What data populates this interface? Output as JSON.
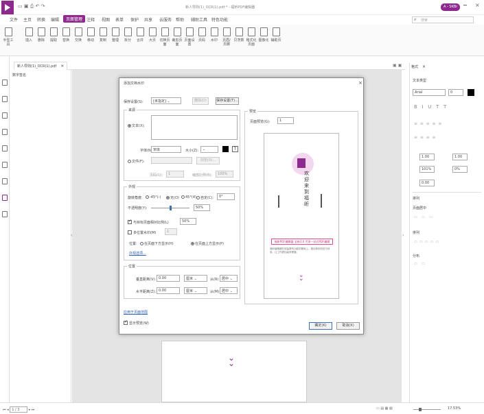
{
  "window": {
    "title": "新人导则(1)_OCR(1).pdf * - 福昕PDF编辑器",
    "user": "A - SKBr"
  },
  "menu": {
    "items": [
      "文件",
      "主页",
      "转换",
      "编辑",
      "页面管理",
      "注释",
      "视图",
      "表单",
      "保护",
      "共享",
      "云服务",
      "帮助"
    ],
    "extra": [
      "辅助工具",
      "特色功能"
    ],
    "search_placeholder": "搜索"
  },
  "ribbon": {
    "buttons": [
      "手型工具",
      "插入",
      "删除",
      "提取",
      "替换",
      "交换",
      "移动",
      "复制",
      "整理",
      "拆分",
      "合并",
      "大页",
      "切换页面",
      "裁剪页面",
      "页面设置",
      "页码",
      "水印",
      "页眉/页脚",
      "贝茨数",
      "格式化页面",
      "图像化",
      "辅助页"
    ]
  },
  "tab": {
    "label": "新人导则(1)_OCR(1).pdf"
  },
  "nav": {
    "label": "数字签名"
  },
  "dialog": {
    "title": "添加文档水印",
    "preset_label": "保存设置(S):",
    "preset_value": "[未指定]",
    "delete_btn": "删除(D)",
    "save_btn": "保存设置(T)...",
    "source_group": "来源",
    "text_radio": "文本(X):",
    "font_label": "字体(N):",
    "font_value": "宋体",
    "size_label": "大小(Z):",
    "file_radio": "文件(F):",
    "browse_btn": "浏览(O)...",
    "page_label": "页码(U):",
    "page_value": "1",
    "scale_label": "缩放比例(B):",
    "scale_value": "100%",
    "appearance_group": "外观",
    "rotate_label": "旋转角度:",
    "rot_options": [
      "-45°(-)",
      "无(O)",
      "45°(4)",
      "自定(C):"
    ],
    "custom_rot": "0°",
    "opacity_label": "不透明度(Y):",
    "opacity_value": "50%",
    "relative_scale_label": "与目标页面相对比例(L)",
    "relative_scale_value": "50%",
    "repeat_label": "多位置水印(M)",
    "repeat_value": "1",
    "location_label": "位置:",
    "behind_option": "在页面下方显示(H)",
    "front_option": "在页面上方显示(P)",
    "advanced_link": "外观选项...",
    "position_group": "位置",
    "vert_label": "垂直距离(V):",
    "vert_value": "0.00",
    "horz_label": "水平距离(Z):",
    "horz_value": "0.00",
    "unit": "厘米",
    "vert_align": "居中",
    "horz_align": "居中",
    "from_label": "从(R)",
    "from_label2": "从(M)",
    "preview_group": "预览",
    "preview_page_label": "页面预览(G):",
    "preview_page_value": "1",
    "preview_vertical_text": "欢迎来到福昕",
    "preview_banner": "福昕PDF编辑器 全新3.0 尽享一站式PDF编辑",
    "preview_body": "福昕编辑器在保留原有功能的基础上，推出新的改进与体验，让工作更加高效便捷。",
    "apply_link": "应用于页面范围",
    "show_preview": "显示预览(W)",
    "ok_btn": "确定(K)",
    "cancel_btn": "取消(X)"
  },
  "right_panel": {
    "tab": "格式",
    "text_style": "文本类型",
    "font_value": "Arial",
    "size_value": "0",
    "spacing_values": [
      "1.00",
      "1.00",
      "101%",
      "0%",
      "0.00"
    ],
    "paragraph": "页面居中",
    "alignment": "排列",
    "distribute": "分布",
    "layout": "排列"
  },
  "status": {
    "page": "1 / 3",
    "zoom": "17.53%"
  },
  "colors": {
    "accent": "#8e2a8e",
    "banner": "#e24a8c"
  }
}
